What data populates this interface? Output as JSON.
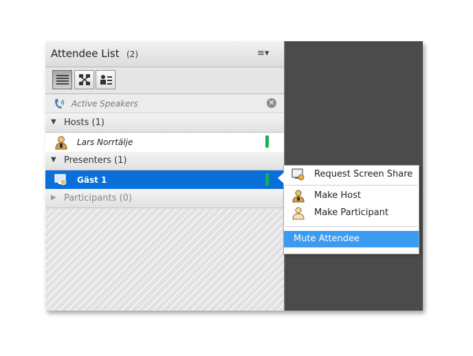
{
  "header": {
    "title": "Attendee List",
    "count": "(2)",
    "menu_icon": "≡▾"
  },
  "toolbar": {
    "buttons": [
      "list-view",
      "grid-view",
      "detail-view"
    ]
  },
  "speakers": {
    "label": "Active Speakers"
  },
  "sections": {
    "hosts": {
      "label": "Hosts (1)",
      "arrow": "▼"
    },
    "presenters": {
      "label": "Presenters (1)",
      "arrow": "▼"
    },
    "participants": {
      "label": "Participants (0)",
      "arrow": "▶"
    }
  },
  "attendees": {
    "host": {
      "name": "Lars Norrtälje"
    },
    "presenter": {
      "name": "Gäst 1"
    }
  },
  "context_menu": {
    "request_screen_share": "Request Screen Share",
    "make_host": "Make Host",
    "make_participant": "Make Participant",
    "mute_attendee": "Mute Attendee"
  },
  "colors": {
    "selected": "#0a6fd8",
    "highlight": "#3a9bf0",
    "level": "#19b14a"
  }
}
